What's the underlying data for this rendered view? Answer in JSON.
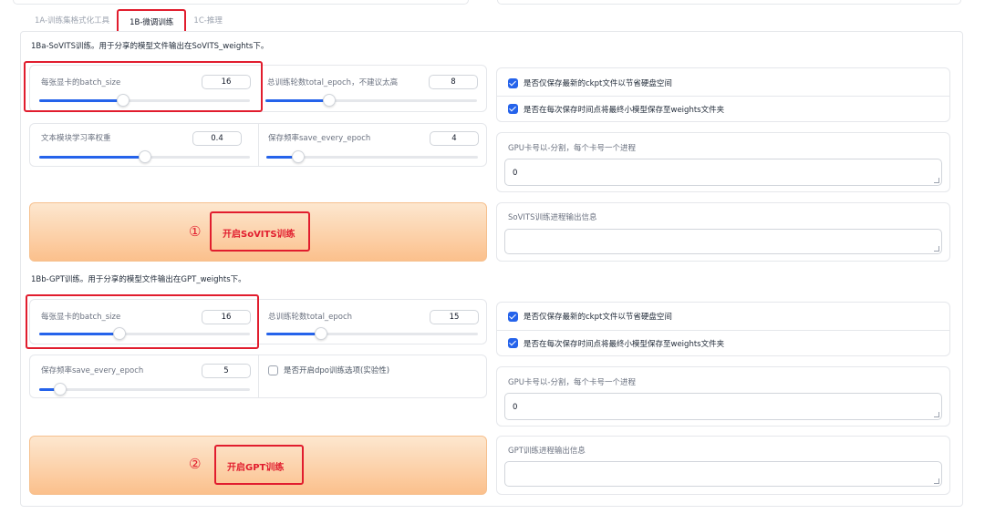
{
  "tabs": [
    {
      "label": "1A-训练集格式化工具",
      "active": false
    },
    {
      "label": "1B-微调训练",
      "active": true
    },
    {
      "label": "1C-推理",
      "active": false
    }
  ],
  "sovits": {
    "section_title": "1Ba-SoVITS训练。用于分享的模型文件输出在SoVITS_weights下。",
    "batch_size": {
      "label": "每张显卡的batch_size",
      "value": "16",
      "level": 0.4
    },
    "total_epoch": {
      "label": "总训练轮数total_epoch，不建议太高",
      "value": "8",
      "level": 0.3
    },
    "text_lr": {
      "label": "文本模块学习率权重",
      "value": "0.4",
      "level": 0.5
    },
    "save_every": {
      "label": "保存频率save_every_epoch",
      "value": "4",
      "level": 0.15
    },
    "checkbox_latest": {
      "label": "是否仅保存最新的ckpt文件以节省硬盘空间",
      "checked": true
    },
    "checkbox_weights": {
      "label": "是否在每次保存时间点将最终小模型保存至weights文件夹",
      "checked": true
    },
    "gpu": {
      "label": "GPU卡号以-分割，每个卡号一个进程",
      "value": "0"
    },
    "output": {
      "label": "SoVITS训练进程输出信息",
      "value": ""
    },
    "button": {
      "marker": "①",
      "label": "开启SoVITS训练"
    }
  },
  "gpt": {
    "section_title": "1Bb-GPT训练。用于分享的模型文件输出在GPT_weights下。",
    "batch_size": {
      "label": "每张显卡的batch_size",
      "value": "16",
      "level": 0.38
    },
    "total_epoch": {
      "label": "总训练轮数total_epoch",
      "value": "15",
      "level": 0.26
    },
    "save_every": {
      "label": "保存频率save_every_epoch",
      "value": "5",
      "level": 0.1
    },
    "checkbox_dpo": {
      "label": "是否开启dpo训练选项(实验性)",
      "checked": false
    },
    "checkbox_latest": {
      "label": "是否仅保存最新的ckpt文件以节省硬盘空间",
      "checked": true
    },
    "checkbox_weights": {
      "label": "是否在每次保存时间点将最终小模型保存至weights文件夹",
      "checked": true
    },
    "gpu": {
      "label": "GPU卡号以-分割，每个卡号一个进程",
      "value": "0"
    },
    "output": {
      "label": "GPT训练进程输出信息",
      "value": ""
    },
    "button": {
      "marker": "②",
      "label": "开启GPT训练"
    }
  },
  "colors": {
    "accent": "#2563eb",
    "highlight": "#e11d2e",
    "button_from": "#fde7cf",
    "button_to": "#fbc08c"
  }
}
